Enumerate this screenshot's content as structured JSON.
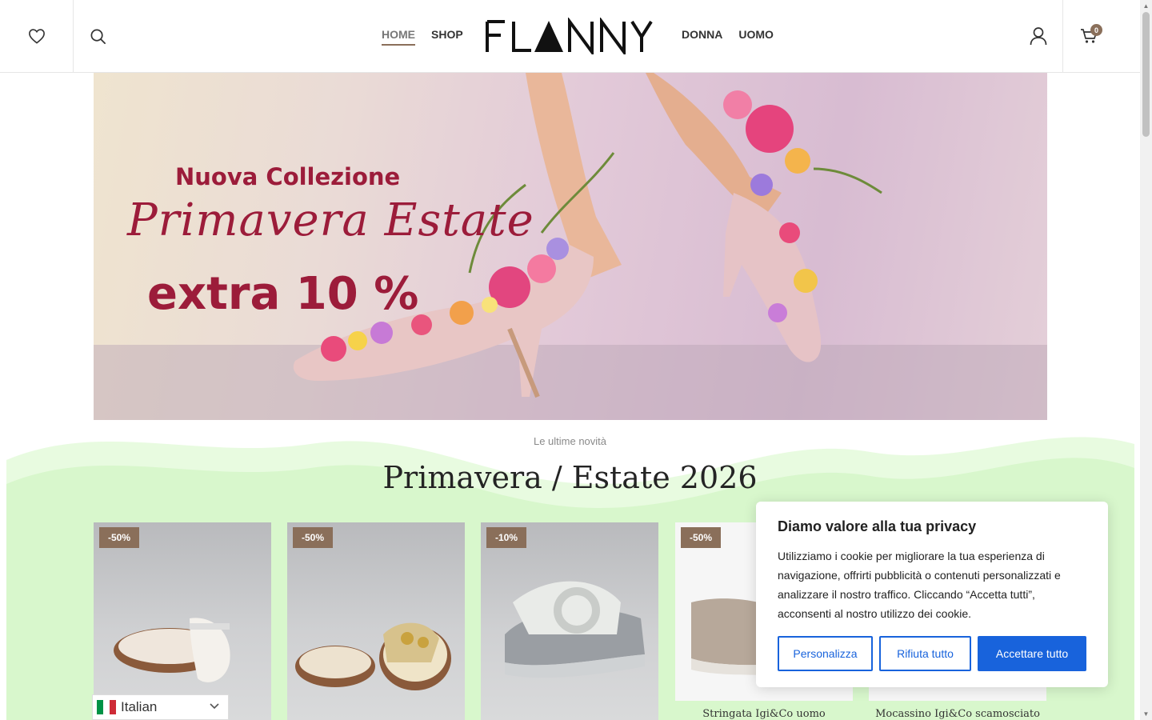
{
  "header": {
    "nav_left": [
      "HOME",
      "SHOP"
    ],
    "nav_right": [
      "DONNA",
      "UOMO"
    ],
    "logo_text": "FLANNY",
    "cart_count": "0",
    "icons": [
      "heart-icon",
      "search-icon",
      "user-icon",
      "cart-icon"
    ]
  },
  "hero": {
    "line1": "Nuova Collezione",
    "line2": "Primavera  Estate",
    "line3": "extra 10 %",
    "text_color": "#9c1c3a"
  },
  "section": {
    "subtitle": "Le ultime novità",
    "title": "Primavera / Estate 2026",
    "background_color": "#d8f7cc"
  },
  "products": [
    {
      "badge": "-50%",
      "title": ""
    },
    {
      "badge": "-50%",
      "title": ""
    },
    {
      "badge": "-10%",
      "title": ""
    },
    {
      "badge": "-50%",
      "title": "Stringata Igi&Co uomo"
    },
    {
      "badge": "",
      "title": "Mocassino Igi&Co scamosciato"
    }
  ],
  "language": {
    "label": "Italian"
  },
  "cookie": {
    "title": "Diamo valore alla tua privacy",
    "text": "Utilizziamo i cookie per migliorare la tua esperienza di navigazione, offrirti pubblicità o contenuti personalizzati e analizzare il nostro traffico. Cliccando “Accetta tutti”, acconsenti al nostro utilizzo dei cookie.",
    "btn_customize": "Personalizza",
    "btn_reject": "Rifiuta tutto",
    "btn_accept": "Accettare tutto",
    "accent_color": "#1863dc"
  },
  "colors": {
    "brand_brown": "#8a6f5a"
  }
}
